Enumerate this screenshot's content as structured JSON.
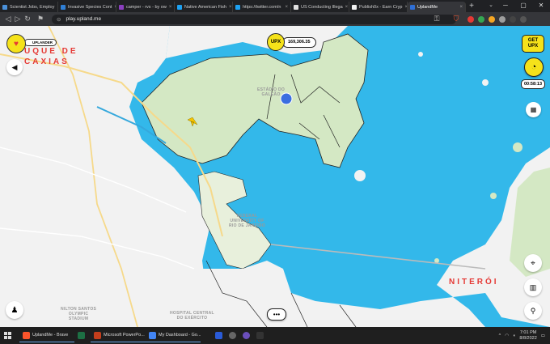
{
  "browser": {
    "tabs": [
      {
        "title": "Scientist Jobs, Employ",
        "color": "#4a90d9"
      },
      {
        "title": "Invasive Species Cont",
        "color": "#2f7fd6"
      },
      {
        "title": "camper - rvs - by ow",
        "color": "#8b3fbf"
      },
      {
        "title": "Native American Fish",
        "color": "#1da1f2"
      },
      {
        "title": "https://twitter.com/n",
        "color": "#1da1f2"
      },
      {
        "title": "US Conducting Illega",
        "color": "#e0e0e0"
      },
      {
        "title": "Publish0x - Earn Cryp",
        "color": "#f0f0f0"
      },
      {
        "title": "UplandMe",
        "color": "#2f6fd6"
      }
    ],
    "url": "play.upland.me"
  },
  "game": {
    "upx_label": "UPX",
    "upx_balance": "169,306.35",
    "get_upx_label": "GET UPX",
    "timer": "00:58:13",
    "rank": "UPLANDER",
    "city_top_left": "UQUE DE\nCAXIAS",
    "city_right": "NITERÓI"
  },
  "map_labels": {
    "estadio": "ESTÁDIO DO\nGALEÃO",
    "federal": "FEDERAL\nUNIVERSITY OF\nRIO DE JANEIRO",
    "nilton": "NILTON SANTOS\nOLYMPIC\nSTADIUM",
    "hospital": "HOSPITAL CENTRAL\nDO EXÉRCITO"
  },
  "taskbar": {
    "items": [
      {
        "label": "UplandMe - Brave",
        "color": "#fb542b"
      },
      {
        "label": "",
        "color": "#1d7044"
      },
      {
        "label": "Microsoft PowerPo...",
        "color": "#c43e1c"
      },
      {
        "label": "My Dashboard - Go...",
        "color": "#4285f4"
      }
    ],
    "time": "7:01 PM",
    "date": "8/8/2022"
  },
  "colors": {
    "water": "#33b8ea",
    "land": "#f2f2f2",
    "park": "#d4e8c4",
    "accent": "#f5e21a"
  }
}
